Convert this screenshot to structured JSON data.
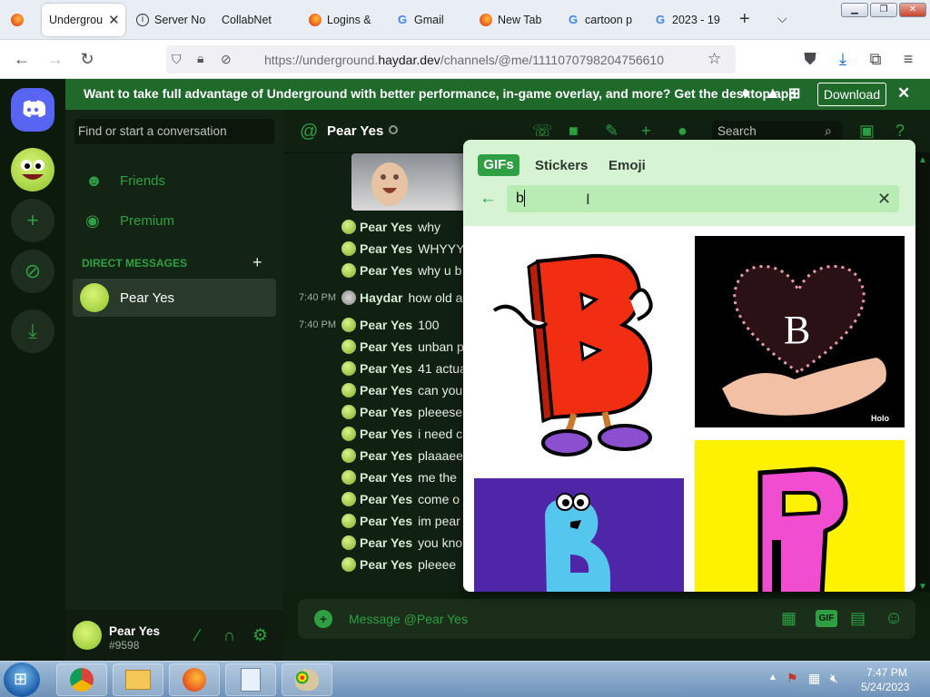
{
  "browser": {
    "tabs": [
      {
        "label": "",
        "icon": "firefox-icon"
      },
      {
        "label": "Undergrou",
        "icon": "discord-icon",
        "active": true
      },
      {
        "label": "Server No",
        "icon": "info-icon"
      },
      {
        "label": "CollabNet",
        "icon": "collabnet-icon"
      },
      {
        "label": "Logins &",
        "icon": "firefox-icon"
      },
      {
        "label": "Gmail",
        "icon": "google-icon"
      },
      {
        "label": "New Tab",
        "icon": "firefox-icon"
      },
      {
        "label": "cartoon p",
        "icon": "google-icon"
      },
      {
        "label": "2023 - 19",
        "icon": "google-icon"
      }
    ],
    "url_prefix": "https://underground.",
    "url_domain": "haydar.dev",
    "url_path": "/channels/@me/1111070798204756610"
  },
  "banner": {
    "text": "Want to take full advantage of Underground with better performance, in-game overlay, and more? Get the desktop app!",
    "download_label": "Download"
  },
  "sidebar": {
    "search_placeholder": "Find or start a conversation",
    "friends_label": "Friends",
    "premium_label": "Premium",
    "dm_header": "DIRECT MESSAGES",
    "dm_items": [
      {
        "name": "Pear Yes"
      }
    ]
  },
  "userbar": {
    "name": "Pear Yes",
    "tag": "#9598"
  },
  "chat": {
    "channel_name": "Pear Yes",
    "search_placeholder": "Search",
    "composer_placeholder": "Message @Pear Yes",
    "messages": [
      {
        "time": "",
        "author": "Pear Yes",
        "text": "why"
      },
      {
        "time": "",
        "author": "Pear Yes",
        "text": "WHYYY"
      },
      {
        "time": "",
        "author": "Pear Yes",
        "text": "why u b"
      },
      {
        "time": "7:40 PM",
        "author": "Haydar",
        "text": "how old a"
      },
      {
        "time": "7:40 PM",
        "author": "Pear Yes",
        "text": "100"
      },
      {
        "time": "",
        "author": "Pear Yes",
        "text": "unban p"
      },
      {
        "time": "",
        "author": "Pear Yes",
        "text": "41 actua"
      },
      {
        "time": "",
        "author": "Pear Yes",
        "text": "can you"
      },
      {
        "time": "",
        "author": "Pear Yes",
        "text": "pleeese"
      },
      {
        "time": "",
        "author": "Pear Yes",
        "text": "i need c"
      },
      {
        "time": "",
        "author": "Pear Yes",
        "text": "plaaaee"
      },
      {
        "time": "",
        "author": "Pear Yes",
        "text": "me the"
      },
      {
        "time": "",
        "author": "Pear Yes",
        "text": "come o"
      },
      {
        "time": "",
        "author": "Pear Yes",
        "text": "im pear"
      },
      {
        "time": "",
        "author": "Pear Yes",
        "text": "you kno"
      },
      {
        "time": "",
        "author": "Pear Yes",
        "text": "pleeee"
      }
    ]
  },
  "picker": {
    "tabs": [
      "GIFs",
      "Stickers",
      "Emoji"
    ],
    "active_tab": "GIFs",
    "query": "b",
    "gifs": [
      {
        "letter": "B",
        "style": "cartoon-red-b"
      },
      {
        "letter": "B",
        "style": "heart-hands",
        "watermark": "Holo"
      },
      {
        "letter": "B",
        "style": "blue-monster"
      },
      {
        "letter": "B",
        "style": "pink-yellow"
      }
    ]
  },
  "taskbar": {
    "time": "7:47 PM",
    "date": "5/24/2023"
  },
  "colors": {
    "accent": "#2ea043",
    "banner": "#1f6a2b",
    "chat_bg": "#112111",
    "picker_bg": "#d6f3d3"
  }
}
